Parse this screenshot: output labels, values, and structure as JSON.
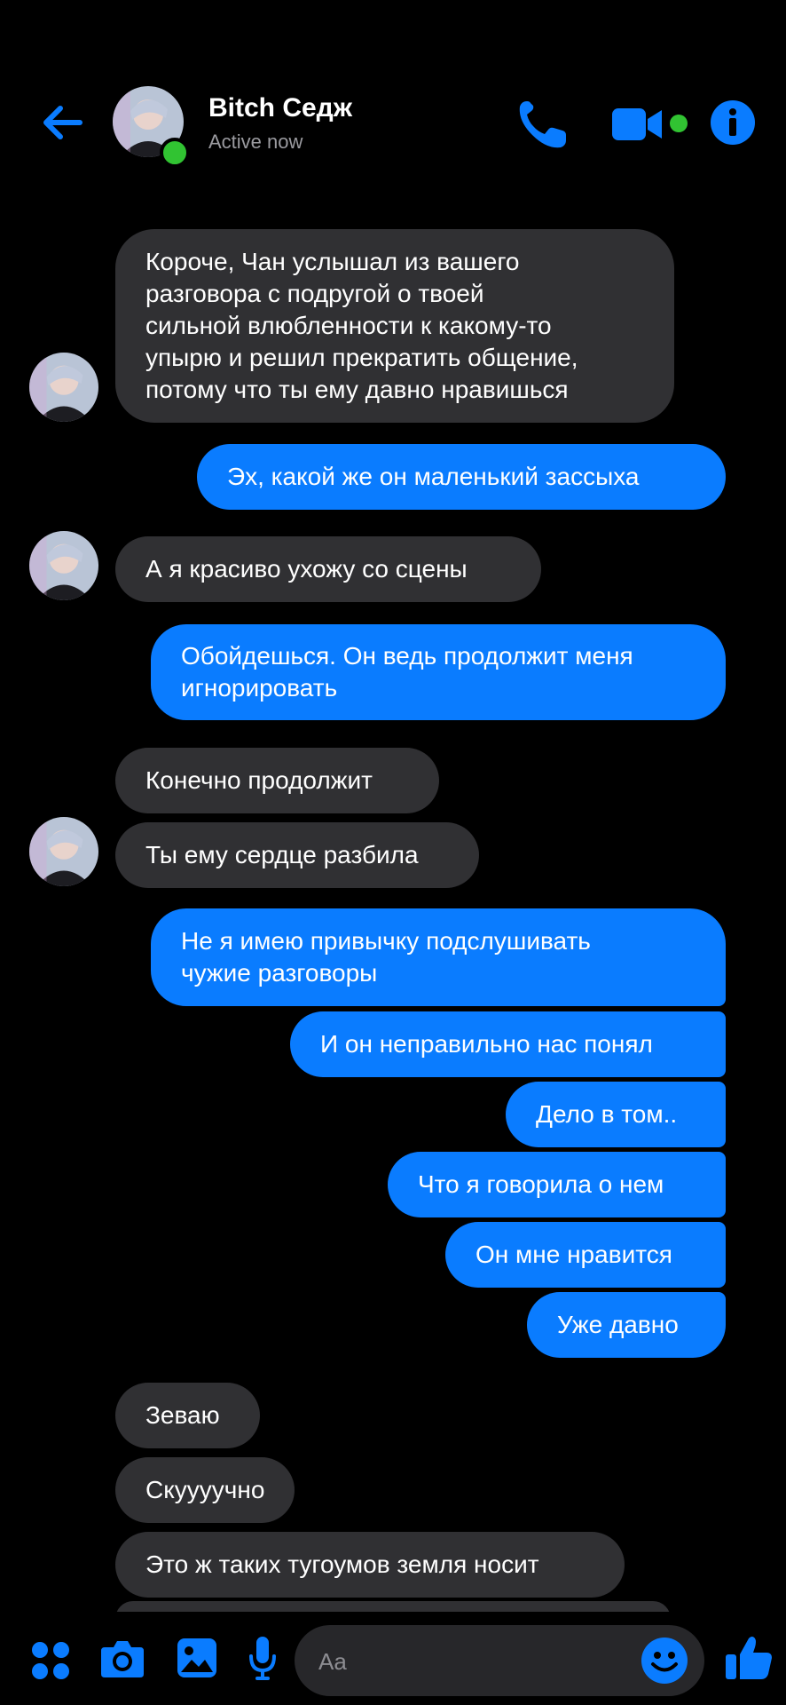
{
  "header": {
    "contact_name": "Bitch Седж",
    "status": "Active now"
  },
  "messages": [
    {
      "from": "them",
      "text": "Короче, Чан услышал из вашего\nразговора с подругой о твоей\nсильной влюбленности к какому-то\nупырю и решил прекратить общение,\nпотому что ты ему давно нравишься"
    },
    {
      "from": "me",
      "text": "Эх, какой же он маленький зассыха"
    },
    {
      "from": "them",
      "text": "А я красиво ухожу со сцены"
    },
    {
      "from": "me",
      "text": "Обойдешься. Он ведь продолжит меня\nигнорировать"
    },
    {
      "from": "them",
      "text": "Конечно продолжит"
    },
    {
      "from": "them",
      "text": "Ты ему сердце разбила"
    },
    {
      "from": "me",
      "text": "Не я имею привычку подслушивать\nчужие разговоры"
    },
    {
      "from": "me",
      "text": "И он неправильно нас понял"
    },
    {
      "from": "me",
      "text": "Дело в том.."
    },
    {
      "from": "me",
      "text": "Что я говорила о нем"
    },
    {
      "from": "me",
      "text": "Он мне нравится"
    },
    {
      "from": "me",
      "text": "Уже давно"
    },
    {
      "from": "them",
      "text": "Зеваю"
    },
    {
      "from": "them",
      "text": "Скуууучно"
    },
    {
      "from": "them",
      "text": "Это ж таких тугоумов земля носит"
    }
  ],
  "composer": {
    "placeholder": "Aa"
  },
  "colors": {
    "accent": "#0a7cff",
    "incoming_bubble": "#303033",
    "online": "#31c332",
    "background": "#000000"
  },
  "icons": [
    "back-arrow-icon",
    "phone-icon",
    "video-camera-icon",
    "info-icon",
    "apps-grid-icon",
    "camera-icon",
    "gallery-icon",
    "microphone-icon",
    "emoji-icon",
    "thumbs-up-icon"
  ]
}
